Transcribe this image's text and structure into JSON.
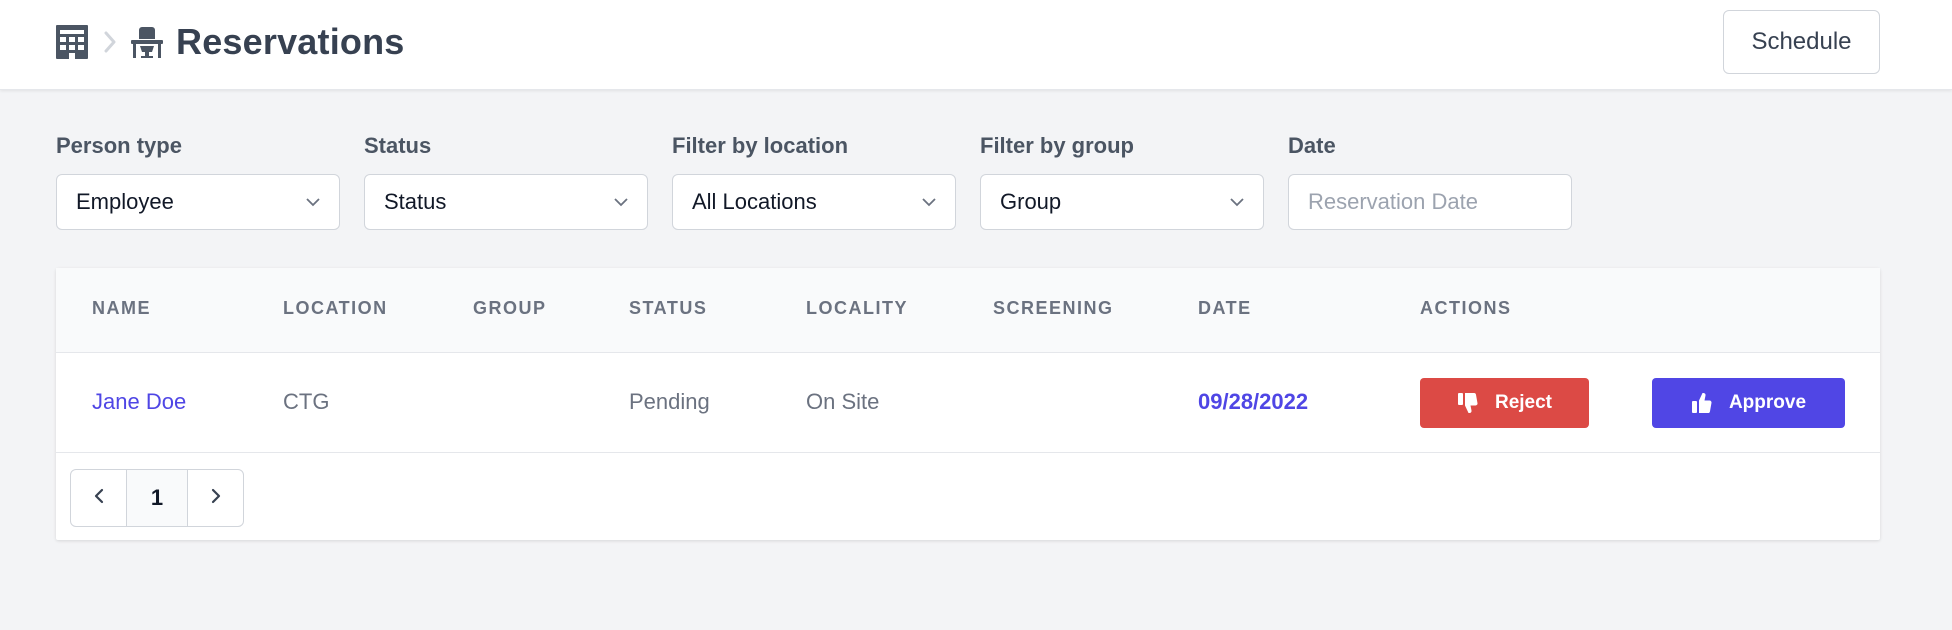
{
  "header": {
    "title": "Reservations",
    "building_icon": "building-icon",
    "separator_icon": "chevron-right-icon",
    "desk_icon": "desk-icon",
    "schedule_label": "Schedule"
  },
  "filters": [
    {
      "label": "Person type",
      "value": "Employee",
      "is_placeholder": false
    },
    {
      "label": "Status",
      "value": "Status",
      "is_placeholder": false
    },
    {
      "label": "Filter by location",
      "value": "All Locations",
      "is_placeholder": false
    },
    {
      "label": "Filter by group",
      "value": "Group",
      "is_placeholder": false
    },
    {
      "label": "Date",
      "value": "Reservation Date",
      "is_placeholder": true
    }
  ],
  "table": {
    "columns": [
      "NAME",
      "LOCATION",
      "GROUP",
      "STATUS",
      "LOCALITY",
      "SCREENING",
      "DATE",
      "ACTIONS"
    ],
    "rows": [
      {
        "name": "Jane Doe",
        "location": "CTG",
        "group": "",
        "status": "Pending",
        "locality": "On Site",
        "screening": "",
        "date": "09/28/2022",
        "reject_label": "Reject",
        "approve_label": "Approve"
      }
    ]
  },
  "pagination": {
    "current_page": "1",
    "prev_icon": "chevron-left-icon",
    "next_icon": "chevron-right-icon"
  },
  "colors": {
    "accent": "#4f46e5",
    "reject": "#dc4a45",
    "approve": "#5046e5"
  }
}
